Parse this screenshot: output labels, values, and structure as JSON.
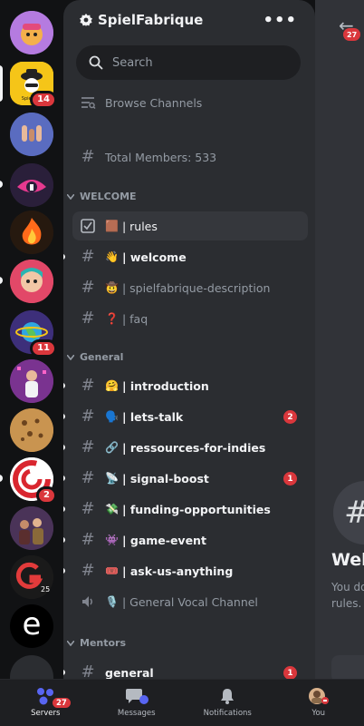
{
  "server": {
    "name": "SpielFabrique",
    "more_label": "•••"
  },
  "search": {
    "placeholder": "Search"
  },
  "browse_channels_label": "Browse Channels",
  "members_channel": {
    "label": "Total Members: 533"
  },
  "categories": {
    "welcome": "WELCOME",
    "general": "General",
    "mentors": "Mentors"
  },
  "welcome_channels": [
    {
      "emoji": "🟫",
      "name": "| rules"
    },
    {
      "emoji": "👋",
      "name": "| welcome"
    },
    {
      "emoji": "🤠",
      "name": "| spielfabrique-description"
    },
    {
      "emoji": "❓",
      "name": "| faq"
    }
  ],
  "general_channels": [
    {
      "emoji": "🤗",
      "name": "| introduction"
    },
    {
      "emoji": "🗣️",
      "name": "| lets-talk",
      "badge": "2"
    },
    {
      "emoji": "🔗",
      "name": "| ressources-for-indies"
    },
    {
      "emoji": "📡",
      "name": "| signal-boost",
      "badge": "1"
    },
    {
      "emoji": "💸",
      "name": "| funding-opportunities"
    },
    {
      "emoji": "👾",
      "name": "| game-event"
    },
    {
      "emoji": "🎟️",
      "name": "| ask-us-anything"
    },
    {
      "emoji": "🎙️",
      "name": "| General Vocal Channel"
    }
  ],
  "mentors_channels": [
    {
      "name": "general",
      "badge": "1"
    }
  ],
  "server_rail": {
    "badges": {
      "s2": "14",
      "s7": "11",
      "s11": "2"
    },
    "partial_letter": "e"
  },
  "peek": {
    "badge": "27",
    "title_partial": "Wel",
    "sub_line1": "You do",
    "sub_line2": "rules."
  },
  "bottom_nav": {
    "servers": {
      "label": "Servers",
      "badge": "27"
    },
    "messages": {
      "label": "Messages"
    },
    "notifications": {
      "label": "Notifications"
    },
    "you": {
      "label": "You"
    }
  },
  "colors": {
    "accent_blue": "#5865f2",
    "badge_red": "#da373c",
    "panel_bg": "#2b2d31",
    "rail_bg": "#111214"
  }
}
